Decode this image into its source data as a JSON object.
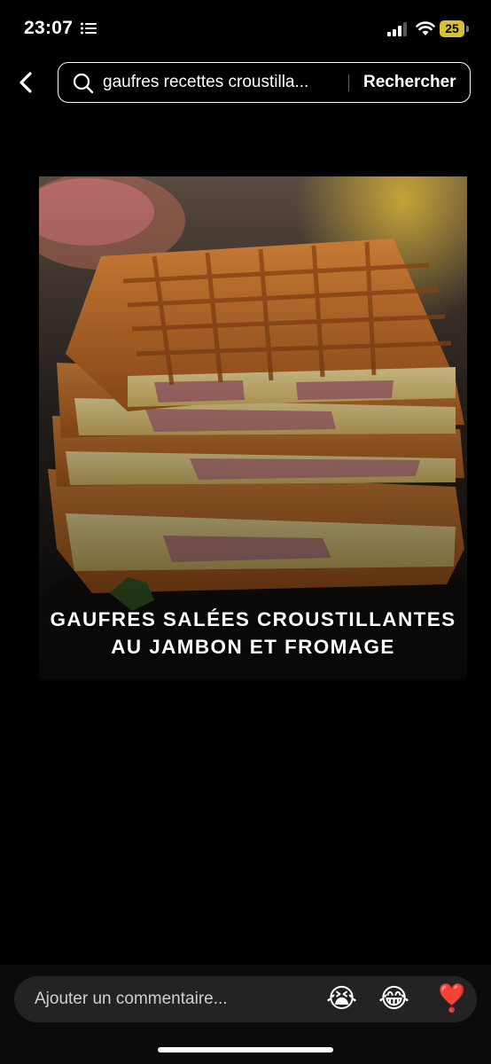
{
  "status_bar": {
    "time": "23:07",
    "battery": "25"
  },
  "search": {
    "query": "gaufres recettes croustilla...",
    "button_label": "Rechercher"
  },
  "post": {
    "image_alt": "Stack of crispy savory waffles filled with ham and melted cheese",
    "caption_line1": "GAUFRES SALÉES CROUSTILLANTES",
    "caption_line2": "AU JAMBON ET FROMAGE"
  },
  "comment_bar": {
    "placeholder": "Ajouter un commentaire...",
    "emojis": [
      "😭",
      "😂",
      "❣️"
    ]
  },
  "colors": {
    "background": "#000000",
    "battery": "#d8c12c",
    "comment_bg": "#232323"
  }
}
